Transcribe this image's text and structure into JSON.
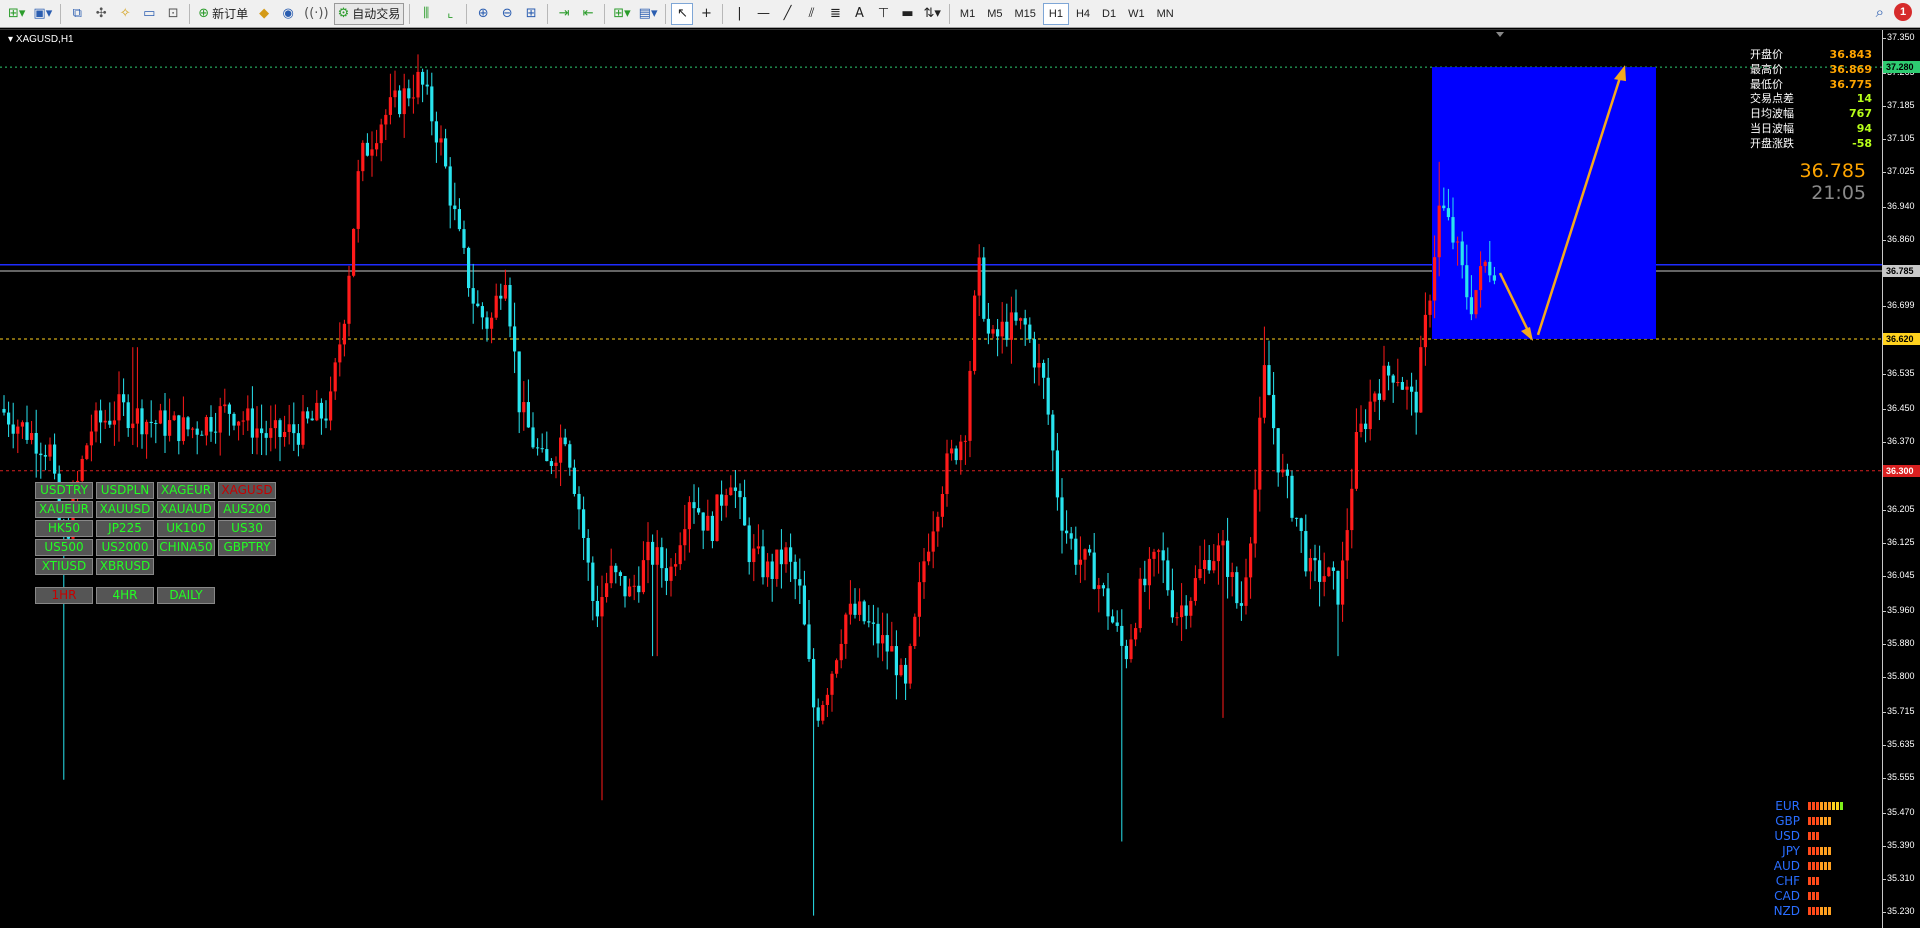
{
  "toolbar": {
    "new_order_label": "新订单",
    "auto_trading_label": "自动交易",
    "timeframes": [
      "M1",
      "M5",
      "M15",
      "H1",
      "H4",
      "D1",
      "W1",
      "MN"
    ],
    "active_timeframe": "H1",
    "notification_count": "1"
  },
  "chart": {
    "title": "XAGUSD,H1",
    "price_ticks": [
      "37.350",
      "37.265",
      "37.185",
      "37.105",
      "37.025",
      "36.940",
      "36.860",
      "36.785",
      "36.699",
      "36.620",
      "36.535",
      "36.450",
      "36.370",
      "36.290",
      "36.205",
      "36.125",
      "36.045",
      "35.960",
      "35.880",
      "35.800",
      "35.715",
      "35.635",
      "35.555",
      "35.470",
      "35.390",
      "35.310",
      "35.230"
    ],
    "price_tags": [
      {
        "label": "37.280",
        "color": "#2ecc71",
        "price": 37.28
      },
      {
        "label": "36.785",
        "color": "#c8c8c8",
        "price": 36.785
      },
      {
        "label": "36.620",
        "color": "#ffd21e",
        "price": 36.62
      },
      {
        "label": "36.300",
        "color": "#d82020",
        "price": 36.3
      }
    ],
    "colors": {
      "bull": "#ff1a1a",
      "bear": "#29e4ef",
      "ma_fast": "#ffff00",
      "ma_mid": "#e01818",
      "ma_slow": "#d81ae0",
      "box": "#0000ff",
      "arrow": "#f2a81d"
    }
  },
  "info_panel": {
    "rows": [
      {
        "label": "开盘价",
        "value": "36.843",
        "color": "#ffa500"
      },
      {
        "label": "最高价",
        "value": "36.869",
        "color": "#ffa500"
      },
      {
        "label": "最低价",
        "value": "36.775",
        "color": "#ffa500"
      },
      {
        "label": "交易点差",
        "value": "14",
        "color": "#b8ff1a"
      },
      {
        "label": "日均波幅",
        "value": "767",
        "color": "#b8ff1a"
      },
      {
        "label": "当日波幅",
        "value": "94",
        "color": "#b8ff1a"
      },
      {
        "label": "开盘涨跌",
        "value": "-58",
        "color": "#b8ff1a"
      }
    ],
    "current_price": "36.785",
    "countdown": "21:05"
  },
  "symbols": {
    "rows": [
      [
        "USDTRY",
        "USDPLN",
        "XAGEUR",
        "XAGUSD"
      ],
      [
        "XAUEUR",
        "XAUUSD",
        "XAUAUD",
        "AUS200"
      ],
      [
        "HK50",
        "JP225",
        "UK100",
        "US30"
      ],
      [
        "US500",
        "US2000",
        "CHINA50",
        "GBPTRY"
      ],
      [
        "XTIUSD",
        "XBRUSD"
      ]
    ],
    "active": [
      "XAGUSD"
    ],
    "timeframes": [
      "1HR",
      "4HR",
      "DAILY"
    ],
    "active_timeframe": "1HR"
  },
  "currency_strength": [
    {
      "label": "EUR",
      "level": 9
    },
    {
      "label": "GBP",
      "level": 6
    },
    {
      "label": "USD",
      "level": 3
    },
    {
      "label": "JPY",
      "level": 6
    },
    {
      "label": "AUD",
      "level": 6
    },
    {
      "label": "CHF",
      "level": 3
    },
    {
      "label": "CAD",
      "level": 3
    },
    {
      "label": "NZD",
      "level": 6
    }
  ]
}
